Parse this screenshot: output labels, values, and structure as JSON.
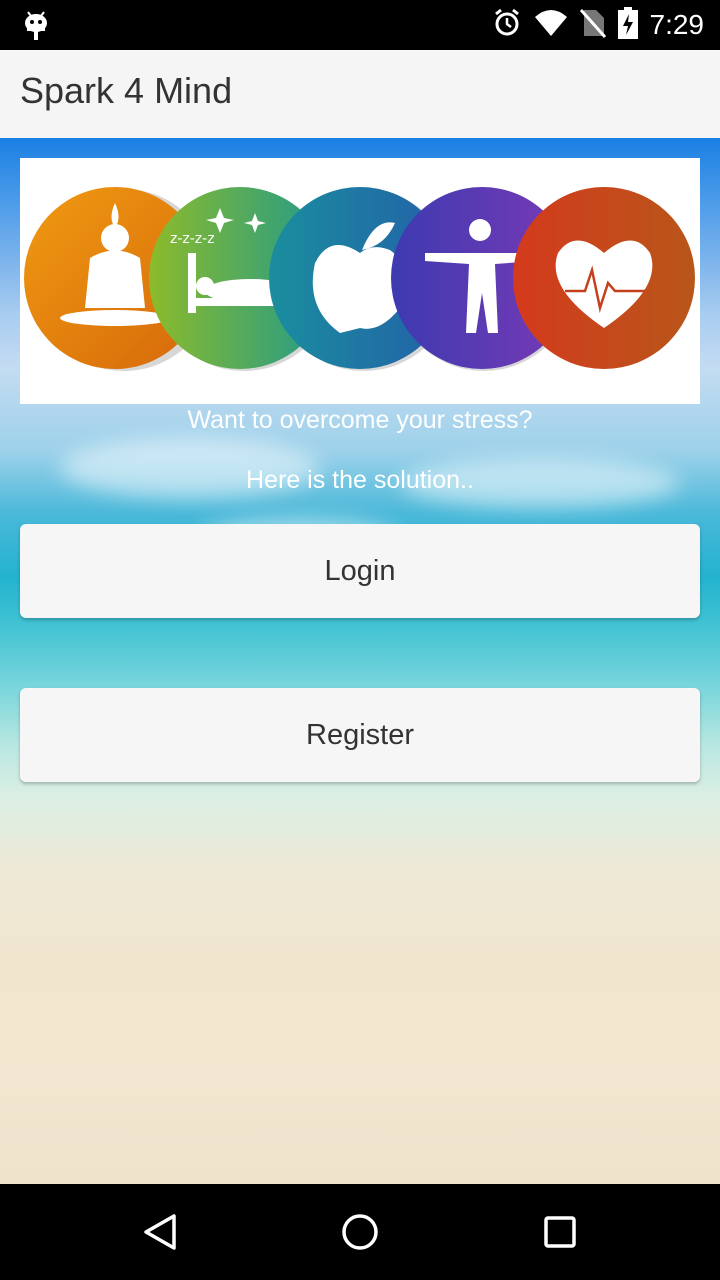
{
  "status_bar": {
    "time": "7:29",
    "icons": [
      "android-debug-icon",
      "alarm-icon",
      "wifi-icon",
      "no-sim-icon",
      "battery-charging-icon"
    ]
  },
  "app_bar": {
    "title": "Spark 4 Mind"
  },
  "banner": {
    "icons": [
      "yoga-icon",
      "sleep-icon",
      "apple-icon",
      "body-icon",
      "heart-icon"
    ],
    "colors": [
      "#e38c0c",
      "#5fb047",
      "#1f7a9c",
      "#5a3fb0",
      "#c4401f"
    ]
  },
  "main": {
    "tagline": "Want to overcome your stress?",
    "subline": "Here is the solution..",
    "login_label": "Login",
    "register_label": "Register"
  },
  "nav_bar": {
    "icons": [
      "back-icon",
      "home-icon",
      "recents-icon"
    ]
  }
}
